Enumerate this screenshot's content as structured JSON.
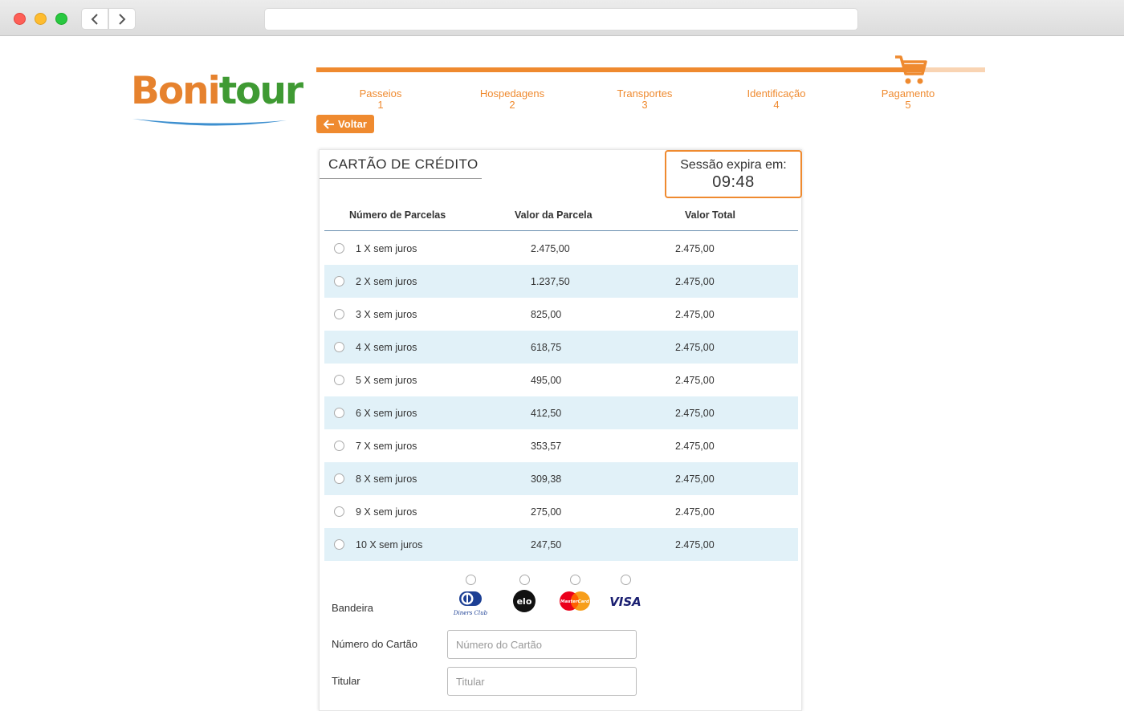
{
  "browser": {
    "url": ""
  },
  "logo": {
    "part1": "Boni",
    "part2": "tour"
  },
  "progress": {
    "fraction": 0.9,
    "steps": [
      {
        "label": "Passeios",
        "num": "1"
      },
      {
        "label": "Hospedagens",
        "num": "2"
      },
      {
        "label": "Transportes",
        "num": "3"
      },
      {
        "label": "Identificação",
        "num": "4"
      },
      {
        "label": "Pagamento",
        "num": "5"
      }
    ]
  },
  "back_button": {
    "label": "Voltar"
  },
  "card": {
    "title": "CARTÃO DE CRÉDITO",
    "session_label": "Sessão expira em:",
    "session_time": "09:48",
    "columns": [
      "Número de Parcelas",
      "Valor da Parcela",
      "Valor Total"
    ],
    "installments": [
      {
        "n": "1   X sem juros",
        "value": "2.475,00",
        "total": "2.475,00"
      },
      {
        "n": "2  X sem juros",
        "value": "1.237,50",
        "total": "2.475,00"
      },
      {
        "n": "3  X sem juros",
        "value": "825,00",
        "total": "2.475,00"
      },
      {
        "n": "4  X sem juros",
        "value": "618,75",
        "total": "2.475,00"
      },
      {
        "n": "5  X sem juros",
        "value": "495,00",
        "total": "2.475,00"
      },
      {
        "n": "6  X sem juros",
        "value": "412,50",
        "total": "2.475,00"
      },
      {
        "n": "7  X sem juros",
        "value": "353,57",
        "total": "2.475,00"
      },
      {
        "n": "8  X sem juros",
        "value": "309,38",
        "total": "2.475,00"
      },
      {
        "n": "9  X sem juros",
        "value": "275,00",
        "total": "2.475,00"
      },
      {
        "n": "10 X sem juros",
        "value": "247,50",
        "total": "2.475,00"
      }
    ],
    "bandeira_label": "Bandeira",
    "brands": [
      "Diners Club",
      "elo",
      "MasterCard",
      "VISA"
    ],
    "card_number": {
      "label": "Número do Cartão",
      "placeholder": "Número do Cartão",
      "value": ""
    },
    "holder": {
      "label": "Titular",
      "placeholder": "Titular",
      "value": ""
    }
  },
  "colors": {
    "accent": "#ef8a2f",
    "row_alt": "#e1f1f8",
    "logo_orange": "#e6822e",
    "logo_green": "#3f9a33"
  }
}
